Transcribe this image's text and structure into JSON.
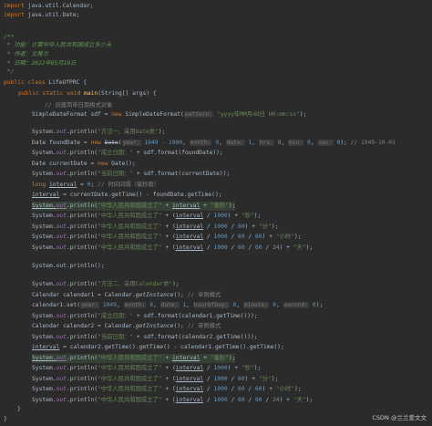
{
  "colors": {
    "background": "#2b2b2b",
    "keyword": "#cc7832",
    "string": "#6a8759",
    "number": "#6897bb",
    "comment": "#808080",
    "doc_comment": "#629755",
    "method": "#ffc66d",
    "field": "#9876aa",
    "text": "#a9b7c6"
  },
  "code": {
    "imp1_kw": "import",
    "imp1_rest": " java.util.Calendar;",
    "imp2_kw": "import",
    "imp2_rest": " java.util.Date;",
    "doc_open": "/**",
    "doc_l1": " * 功能：计算中华人民共和国成立多少天",
    "doc_l2": " * 作者：文雅兰",
    "doc_l3": " * 日期：2022年05月19日",
    "doc_close": " */",
    "cls_kw": "public class",
    "cls_name": " LifeOfPRC {",
    "main_kw": "public static void",
    "main_name": "main",
    "main_rest": "(String[] args) {",
    "c1": "// 创建简单日期格式对象",
    "sdf_a": "SimpleDateFormat sdf = ",
    "sdf_new": "new",
    "sdf_b": " SimpleDateFormat(",
    "sdf_hint": "pattern:",
    "sdf_str": "\"yyyy年MM月dd日 HH:mm:ss\"",
    "sdf_end": ");",
    "p1a": "System.",
    "p1out": "out",
    "p1b": ".println(",
    "p1s": "\"方法一、采用Date类\"",
    "p1e": ");",
    "fd_a": "Date foundDate = ",
    "fd_new": "new",
    "fd_date": "Date",
    "fd_p": "(",
    "fd_h1": "year:",
    "fd_v1": "1949 - 1900",
    "fd_h2": "month:",
    "fd_v2": "9",
    "fd_h3": "date:",
    "fd_v3": "1",
    "fd_h4": "hrs:",
    "fd_v4": "8",
    "fd_h5": "min:",
    "fd_v5": "0",
    "fd_h6": "sec:",
    "fd_v6": "0",
    "fd_end": "); ",
    "fd_cmt": "// 1949-10-01",
    "pr_found_s": "\"成立日期：\"",
    "pr_found_rest": " + sdf.format(foundDate));",
    "cd_a": "Date currentDate = ",
    "cd_new": "new",
    "cd_b": " Date();",
    "pr_cur_s": "\"当前日期：\"",
    "pr_cur_rest": " + sdf.format(currentDate));",
    "long_kw": "long",
    "long_var": "interval",
    "long_eq": " = ",
    "long_zero": "0",
    "long_cmt": "// 时间间隔（毫秒数）",
    "iv_var": "interval",
    "iv_rest": " = currentDate.getTime() - foundDate.getTime();",
    "r_s": "\"中华人民共和国成立了\"",
    "r_plus": " + ",
    "r_iv": "interval",
    "r_ms": "\"毫秒\"",
    "r_sec": "\"秒\"",
    "r_min": "\"分\"",
    "r_hour": "\"小时\"",
    "r_day": "\"天\"",
    "n1000": "1000",
    "n60": "60",
    "n24": "24",
    "div": " / ",
    "lp": "(",
    "rp": ")",
    "end": ");",
    "empty_println": "System.out.println();",
    "p2s": "\"方法二、采用Calendar类\"",
    "cal1_a": "Calendar calendar1 = Calendar.",
    "cal_gi": "getInstance",
    "cal1_b": "(); ",
    "cal1_cmt": "// 单例模式",
    "set_a": "calendar1.set(",
    "set_h1": "year:",
    "set_v1": "1949",
    "set_h2": "month:",
    "set_v2": "9",
    "set_h3": "date:",
    "set_v3": "1",
    "set_h4": "hourOfDay:",
    "set_v4": "8",
    "set_h5": "minute:",
    "set_v5": "0",
    "set_h6": "second:",
    "set_v6": "0",
    "set_end": ");",
    "pr_cal1_rest": " + sdf.format(calendar1.getTime()));",
    "cal2_a": "Calendar calendar2 = Calendar.",
    "pr_cal2_rest": " + sdf.format(calendar2.getTime()));",
    "iv2_rest": " = calendar2.getTime().getTime() - calendar1.getTime().getTime();",
    "close_main": "}",
    "close_cls": "}"
  },
  "watermark": "CSDN @兰兰爱文文"
}
